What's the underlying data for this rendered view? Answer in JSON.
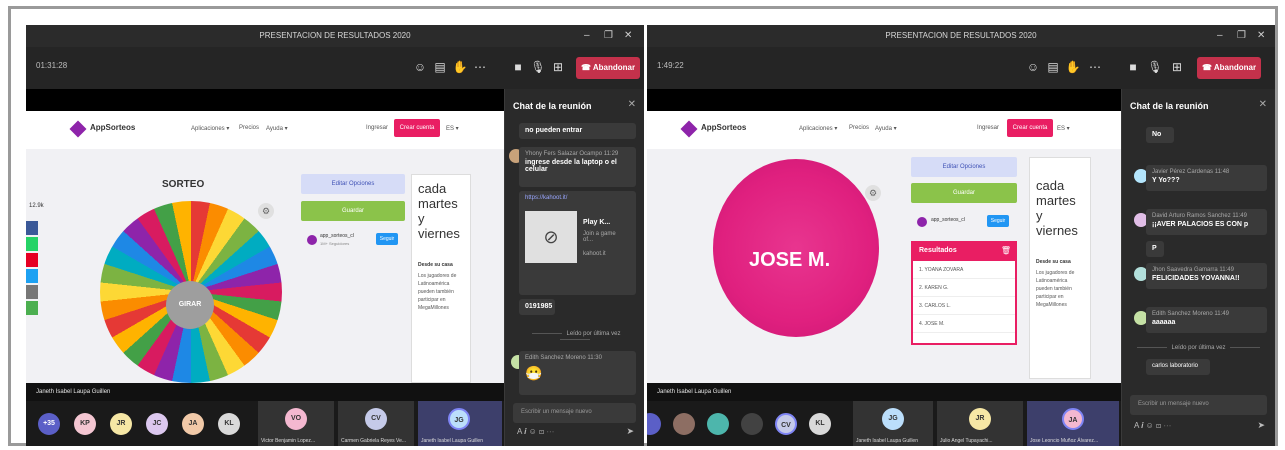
{
  "window_title": "PRESENTACION DE RESULTADOS 2020",
  "leave_label": "Abandonar",
  "left": {
    "timer": "01:31:28",
    "website": {
      "logo": "AppSorteos",
      "nav": [
        "Aplicaciones ▾",
        "Precios",
        "Ayuda ▾"
      ],
      "login": "Ingresar",
      "create_account": "Crear cuenta",
      "lang": "ES ▾",
      "section_title": "SORTEO",
      "share_count": "12.9k",
      "spin_label": "GIRAR",
      "edit_options": "Editar Opciones",
      "primary_button": "Guardar",
      "account_name": "app_sorteos_cl",
      "account_sub": "1M+ Seguidores",
      "follow": "Seguir",
      "ad_big": "cada martes y viernes",
      "ad_small": "Desde su casa",
      "ad_body": "Los jugadores de Latinoamérica pueden también participar en MegaMillones"
    },
    "chat": {
      "title": "Chat de la reunión",
      "partial_text": "no pueden entrar",
      "messages": [
        {
          "name": "Yhony Fers Salazar Ocampo  11:29",
          "text": "ingrese desde la laptop o el celular"
        }
      ],
      "link_url": "https://kahoot.it/",
      "link_card_title": "Play K...",
      "link_card_desc": "Join a game of...",
      "link_card_site": "kahoot.it",
      "code": "0191985",
      "read_by": "Leído por última vez",
      "last_msg_name": "Edith Sanchez Moreno  11:30",
      "input_placeholder": "Escribir un mensaje nuevo"
    },
    "presenter_name": "Janeth Isabel Laupa Guillen",
    "participants": [
      {
        "initials": "+35",
        "color": "#5b5fc7"
      },
      {
        "initials": "KP",
        "color": "#f4c6d2"
      },
      {
        "initials": "JR",
        "color": "#f6e7a5"
      },
      {
        "initials": "JC",
        "color": "#dcc8ef"
      },
      {
        "initials": "JA",
        "color": "#f1c9a8"
      },
      {
        "initials": "KL",
        "color": "#d9d9d9"
      }
    ],
    "tiles": [
      {
        "initials": "VO",
        "color": "#f4b8d0",
        "name": "Victor Benjamin Lopez..."
      },
      {
        "initials": "CV",
        "color": "#c5cae9",
        "name": "Carmen Gabriela Reyes Ve..."
      },
      {
        "initials": "JG",
        "color": "#bbdefb",
        "name": "Janeth Isabel Laupa Guillen"
      }
    ]
  },
  "right": {
    "timer": "1:49:22",
    "website": {
      "logo": "AppSorteos",
      "nav": [
        "Aplicaciones ▾",
        "Precios",
        "Ayuda ▾"
      ],
      "login": "Ingresar",
      "create_account": "Crear cuenta",
      "lang": "ES ▾",
      "winner": "JOSE M.",
      "edit_options": "Editar Opciones",
      "primary_button": "Guardar",
      "account_name": "app_sorteos_cl",
      "follow": "Seguir",
      "results_title": "Resultados",
      "results": [
        "1.  YOANA ZOVARA",
        "2.  KAREN G.",
        "3.  CARLOS L.",
        "4.  JOSE M."
      ],
      "ad_big": "cada martes y viernes",
      "ad_small": "Desde su casa",
      "ad_body": "Los jugadores de Latinoamérica pueden también participar en MegaMillones"
    },
    "chat": {
      "title": "Chat de la reunión",
      "bubble_no": "No",
      "messages": [
        {
          "name": "Javier Pérez Cardenas  11:48",
          "text": "Y Yo???"
        },
        {
          "name": "David Arturo Ramos Sanchez  11:49",
          "text": "¡¡AVER PALACIOS ES CON p"
        },
        {
          "name": "Jhon Saavedra Gamarra  11:49",
          "text": "FELICIDADES YOVANNA!!"
        },
        {
          "name": "Edith Sanchez Moreno  11:49",
          "text": "aaaaaa"
        }
      ],
      "bubble_p": "P",
      "read_by": "Leído por última vez",
      "last_bubble": "carlos laboratorio",
      "input_placeholder": "Escribir un mensaje nuevo"
    },
    "presenter_name": "Janeth Isabel Laupa Guillen",
    "tiles": [
      {
        "initials": "JG",
        "color": "#bbdefb",
        "name": "Janeth Isabel Laupa Guillen"
      },
      {
        "initials": "JR",
        "color": "#f6e7a5",
        "name": "Julio Angel Tupayachi..."
      },
      {
        "initials": "JA",
        "color": "#f4b8d0",
        "name": "Jose Leoncio Muñoz Álvarez..."
      }
    ],
    "participants": [
      {
        "initials": "CV",
        "color": "#c5cae9"
      },
      {
        "initials": "KL",
        "color": "#d9d9d9"
      }
    ]
  }
}
